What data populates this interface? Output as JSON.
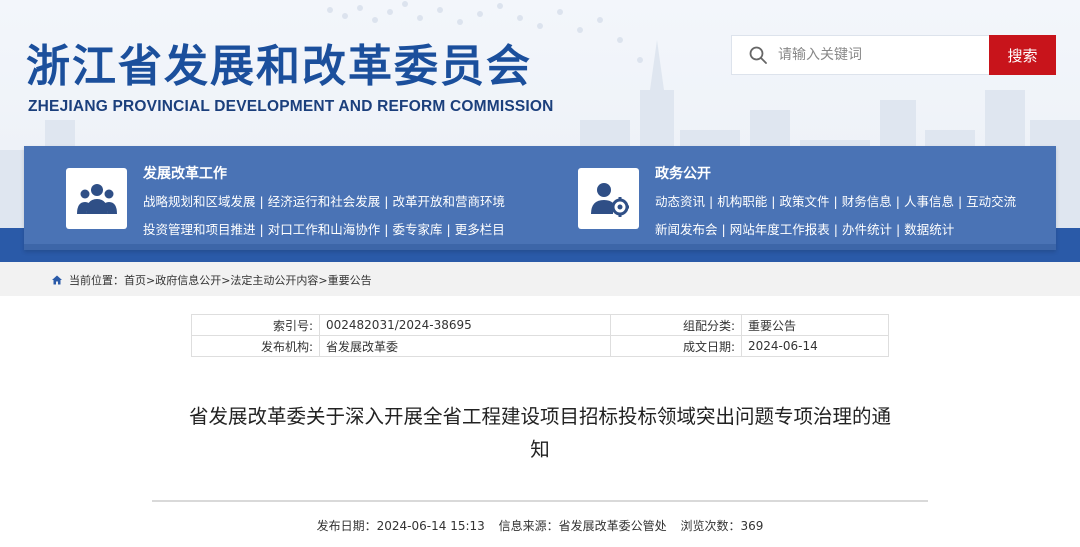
{
  "site": {
    "name_cn": "浙江省发展和改革委员会",
    "name_en": "ZHEJIANG PROVINCIAL DEVELOPMENT AND REFORM COMMISSION"
  },
  "search": {
    "placeholder": "请输入关键词",
    "button": "搜索"
  },
  "nav": {
    "left": {
      "title": "发展改革工作",
      "row1": [
        "战略规划和区域发展",
        "经济运行和社会发展",
        "改革开放和营商环境"
      ],
      "row2": [
        "投资管理和项目推进",
        "对口工作和山海协作",
        "委专家库",
        "更多栏目"
      ]
    },
    "right": {
      "title": "政务公开",
      "row1": [
        "动态资讯",
        "机构职能",
        "政策文件",
        "财务信息",
        "人事信息",
        "互动交流"
      ],
      "row2": [
        "新闻发布会",
        "网站年度工作报表",
        "办件统计",
        "数据统计"
      ]
    },
    "separator": "|"
  },
  "breadcrumb": {
    "prefix": "当前位置：",
    "path": "首页>政府信息公开>法定主动公开内容>重要公告"
  },
  "meta": {
    "index_label": "索引号:",
    "index_value": "002482031/2024-38695",
    "category_label": "组配分类:",
    "category_value": "重要公告",
    "org_label": "发布机构:",
    "org_value": "省发展改革委",
    "date_label": "成文日期:",
    "date_value": "2024-06-14"
  },
  "article": {
    "title_line1": "省发展改革委关于深入开展全省工程建设项目招标投标领域突出问题专项治理的通",
    "title_line2": "知"
  },
  "pubinfo": {
    "date": "发布日期：2024-06-14 15:13",
    "source": "信息来源：省发展改革委公管处",
    "views": "浏览次数：369"
  }
}
